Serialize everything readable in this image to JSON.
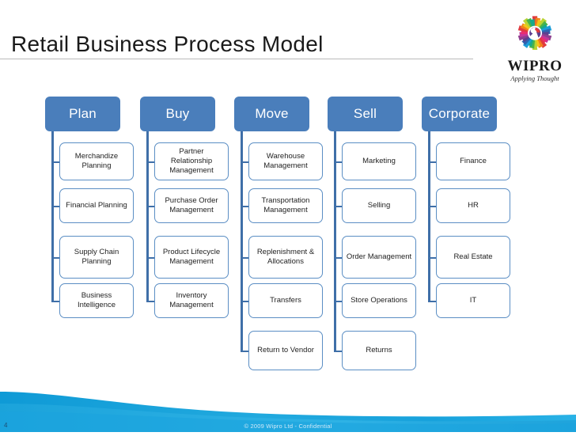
{
  "slide": {
    "title": "Retail Business Process Model",
    "page_number": "4",
    "copyright": "© 2009 Wipro Ltd -  Confidential"
  },
  "logo": {
    "wordmark": "WIPRO",
    "tagline": "Applying Thought"
  },
  "colors": {
    "header_box_fill": "#4a7ebb",
    "connector": "#3f6fa8",
    "sub_box_border": "#5b8ec4",
    "footer_wave": "#1ba3dd",
    "title_rule": "#b9b9b9"
  },
  "columns": [
    {
      "title": "Plan",
      "items": [
        "Merchandize Planning",
        "Financial Planning",
        "Supply Chain Planning",
        "Business Intelligence"
      ]
    },
    {
      "title": "Buy",
      "items": [
        "Partner Relationship Management",
        "Purchase Order Management",
        "Product Lifecycle Management",
        "Inventory Management"
      ]
    },
    {
      "title": "Move",
      "items": [
        "Warehouse Management",
        "Transportation Management",
        "Replenishment & Allocations",
        "Transfers",
        "Return to Vendor"
      ]
    },
    {
      "title": "Sell",
      "items": [
        "Marketing",
        "Selling",
        "Order Management",
        "Store Operations",
        "Returns"
      ]
    },
    {
      "title": "Corporate",
      "items": [
        "Finance",
        "HR",
        "Real Estate",
        "IT"
      ]
    }
  ]
}
